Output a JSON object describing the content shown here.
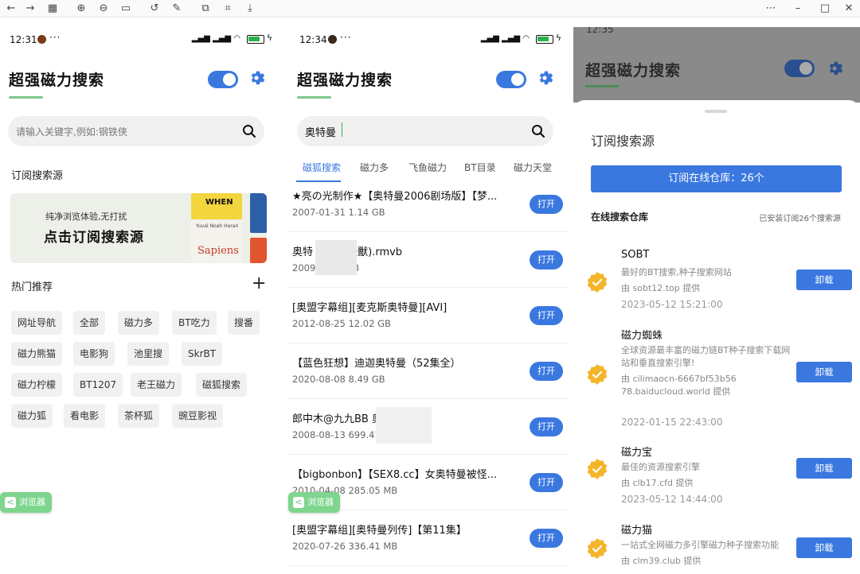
{
  "panels": {
    "home": {
      "status": {
        "time": "12:31"
      },
      "app_title": "超强磁力搜索",
      "search": {
        "placeholder": "请输入关键字,例如:钢铁侠"
      },
      "sources_heading": "订阅搜索源",
      "banner": {
        "line1": "纯净浏览体验,无打扰",
        "line2": "点击订阅搜索源",
        "book1": "WHEN",
        "book2": "Yuval Noah Harari",
        "book3": "Sapiens"
      },
      "hot_heading": "热门推荐",
      "chips": [
        "网址导航",
        "全部",
        "磁力多",
        "BT吃力",
        "搜番",
        "磁力熊猫",
        "电影狗",
        "池里搜",
        "SkrBT",
        "磁力柠檬",
        "BT1207",
        "老王磁力",
        "磁狐搜索",
        "磁力狐",
        "看电影",
        "茶杯狐",
        "豌豆影视"
      ],
      "browser_label": "浏览器"
    },
    "results": {
      "status": {
        "time": "12:34"
      },
      "app_title": "超强磁力搜索",
      "search": {
        "value": "奥特曼"
      },
      "tabs": [
        "磁狐搜索",
        "磁力多",
        "飞鱼磁力",
        "BT目录",
        "磁力天堂"
      ],
      "items": [
        {
          "title": "★亮の光制作★【奥特曼2006剧场版】【梦...",
          "meta": "2007-01-31 1.14 GB",
          "action": "打开"
        },
        {
          "title": "奥特      超人與怪獸).rmvb",
          "meta": "2009-1      .45 MB",
          "action": "打开"
        },
        {
          "title": "[奥盟字幕组][麦克斯奥特曼][AVI]",
          "meta": "2012-08-25 12.02 GB",
          "action": "打开"
        },
        {
          "title": "【蓝色狂想】迪迦奥特曼（52集全）",
          "meta": "2020-08-08 8.49 GB",
          "action": "打开"
        },
        {
          "title": "郎中木@九九BB          奥特曼",
          "meta": "2008-08-13 699.41 N",
          "action": "打开"
        },
        {
          "title": "【bigbonbon】【SEX8.cc】女奥特曼被怪...",
          "meta": "2010-04-08 285.05 MB",
          "action": "打开"
        },
        {
          "title": "[奥盟字幕组][奥特曼列传]【第11集】",
          "meta": "2020-07-26 336.41 MB",
          "action": "打开"
        }
      ],
      "browser_label": "浏览器"
    },
    "subscribe": {
      "status": {
        "time": "12:35"
      },
      "app_title": "超强磁力搜索",
      "sheet_title": "订阅搜索源",
      "subscribe_button": "订阅在线仓库：26个",
      "repo_heading": "在线搜索仓库",
      "installed_note": "已安装订阅26个搜索源",
      "sources": [
        {
          "name": "SOBT",
          "desc": "最好的BT搜索,种子搜索网站",
          "provider": "由 sobt12.top 提供",
          "date": "2023-05-12 15:21:00",
          "action": "卸载"
        },
        {
          "name": "磁力蜘蛛",
          "desc": "全球资源最丰富的磁力链BT种子搜索下载网站和垂直搜索引擎!",
          "provider": "由 cilimaocn-6667bf53b5678.baiducloud.world 提供",
          "date": "2022-01-15 22:43:00",
          "action": "卸载"
        },
        {
          "name": "磁力宝",
          "desc": "最佳的资源搜索引擎",
          "provider": "由 clb17.cfd 提供",
          "date": "2023-05-12 14:44:00",
          "action": "卸载"
        },
        {
          "name": "磁力猫",
          "desc": "一站式全网磁力多引擎磁力种子搜索功能",
          "provider": "由 clm39.club 提供",
          "date": "",
          "action": "卸载"
        }
      ]
    }
  },
  "colors": {
    "accent": "#3a78e0",
    "green": "#7dc78a",
    "badge": "#f3b52a"
  }
}
